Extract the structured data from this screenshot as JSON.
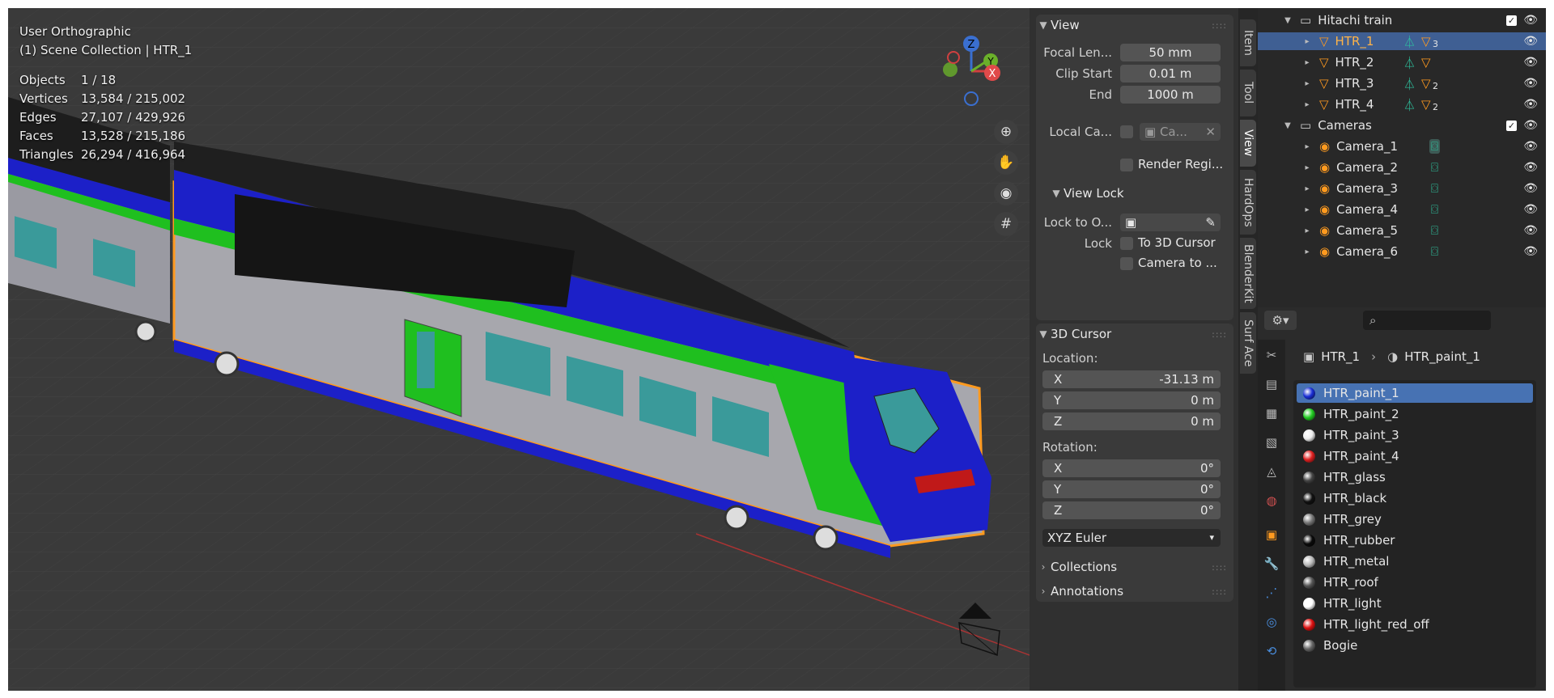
{
  "viewport": {
    "view_name": "User Orthographic",
    "context": "(1) Scene Collection | HTR_1",
    "stats": [
      {
        "label": "Objects",
        "value": "1 / 18"
      },
      {
        "label": "Vertices",
        "value": "13,584 / 215,002"
      },
      {
        "label": "Edges",
        "value": "27,107 / 429,926"
      },
      {
        "label": "Faces",
        "value": "13,528 / 215,186"
      },
      {
        "label": "Triangles",
        "value": "26,294 / 416,964"
      }
    ],
    "gizmo": {
      "z": "Z",
      "y": "Y",
      "x": "X"
    },
    "buttons": [
      "zoom-icon",
      "pan-hand-icon",
      "camera-view-icon",
      "grid-icon"
    ]
  },
  "npanel": {
    "view": {
      "title": "View",
      "focal_label": "Focal Len...",
      "focal_value": "50 mm",
      "clip_start_label": "Clip Start",
      "clip_start_value": "0.01 m",
      "end_label": "End",
      "end_value": "1000 m",
      "local_cam_label": "Local Ca...",
      "local_cam_value": "Ca...",
      "render_region_label": "Render Regi..."
    },
    "view_lock": {
      "title": "View Lock",
      "lock_to_label": "Lock to O...",
      "lock_label": "Lock",
      "to_cursor_label": "To 3D Cursor",
      "camera_to_label": "Camera to ..."
    },
    "cursor": {
      "title": "3D Cursor",
      "location_label": "Location:",
      "loc": [
        {
          "axis": "X",
          "value": "-31.13 m"
        },
        {
          "axis": "Y",
          "value": "0 m"
        },
        {
          "axis": "Z",
          "value": "0 m"
        }
      ],
      "rotation_label": "Rotation:",
      "rot": [
        {
          "axis": "X",
          "value": "0°"
        },
        {
          "axis": "Y",
          "value": "0°"
        },
        {
          "axis": "Z",
          "value": "0°"
        }
      ],
      "mode": "XYZ Euler"
    },
    "collections_title": "Collections",
    "annotations_title": "Annotations"
  },
  "tabs": [
    "Item",
    "Tool",
    "View",
    "HardOps",
    "BlenderKit",
    "Surf Ace"
  ],
  "outliner": {
    "train_collection": "Hitachi train",
    "trains": [
      {
        "name": "HTR_1",
        "count": "3"
      },
      {
        "name": "HTR_2",
        "count": ""
      },
      {
        "name": "HTR_3",
        "count": "2"
      },
      {
        "name": "HTR_4",
        "count": "2"
      }
    ],
    "camera_collection": "Cameras",
    "cameras": [
      "Camera_1",
      "Camera_2",
      "Camera_3",
      "Camera_4",
      "Camera_5",
      "Camera_6"
    ]
  },
  "properties": {
    "object": "HTR_1",
    "material": "HTR_paint_1",
    "materials": [
      {
        "name": "HTR_paint_1",
        "color": "#1a2fd6"
      },
      {
        "name": "HTR_paint_2",
        "color": "#22cc22"
      },
      {
        "name": "HTR_paint_3",
        "color": "#eeeeee"
      },
      {
        "name": "HTR_paint_4",
        "color": "#e02020"
      },
      {
        "name": "HTR_glass",
        "color": "#444444"
      },
      {
        "name": "HTR_black",
        "color": "#111111"
      },
      {
        "name": "HTR_grey",
        "color": "#777777"
      },
      {
        "name": "HTR_rubber",
        "color": "#0a0a0a"
      },
      {
        "name": "HTR_metal",
        "color": "#bbbbbb"
      },
      {
        "name": "HTR_roof",
        "color": "#555555"
      },
      {
        "name": "HTR_light",
        "color": "#ffffff"
      },
      {
        "name": "HTR_light_red_off",
        "color": "#dd1111"
      },
      {
        "name": "Bogie",
        "color": "#666666"
      }
    ]
  },
  "colors": {
    "selection": "#4772b3",
    "outliner_sel": "#3f5f93",
    "train_blue": "#1c20c8",
    "train_green": "#1fbf1f",
    "outline": "#ff9a1f"
  }
}
